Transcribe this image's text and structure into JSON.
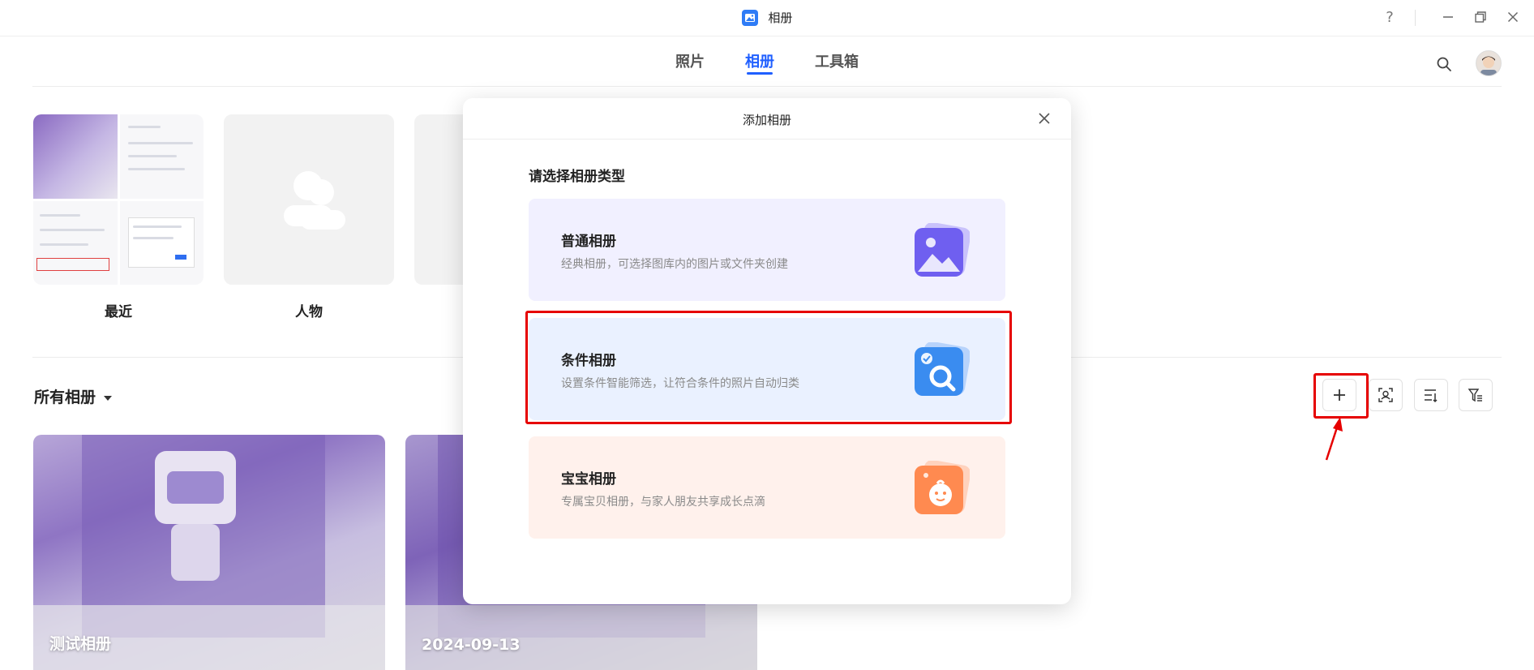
{
  "app": {
    "title": "相册",
    "icon": "album-icon",
    "accent": "#1f5fff"
  },
  "window_controls": {
    "help": "?",
    "minimize_icon": "minimize-icon",
    "restore_icon": "restore-icon",
    "close_icon": "close-icon"
  },
  "nav": {
    "tabs": [
      "照片",
      "相册",
      "工具箱"
    ],
    "active_tab": "相册"
  },
  "top_albums": [
    {
      "label": "最近"
    },
    {
      "label": "人物"
    }
  ],
  "section": {
    "title": "所有相册"
  },
  "toolbar": {
    "add": "plus-icon",
    "face_scan": "face-scan-icon",
    "sort": "sort-icon",
    "filter": "filter-icon"
  },
  "photo_albums": [
    {
      "label": "测试相册"
    },
    {
      "label": "2024-09-13"
    }
  ],
  "modal": {
    "title": "添加相册",
    "subtitle": "请选择相册类型",
    "options": [
      {
        "name": "普通相册",
        "desc": "经典相册，可选择图库内的图片或文件夹创建",
        "icon": "image-icon",
        "color": "#6f5ff0"
      },
      {
        "name": "条件相册",
        "desc": "设置条件智能筛选，让符合条件的照片自动归类",
        "icon": "smart-search-icon",
        "color": "#3a8cf0"
      },
      {
        "name": "宝宝相册",
        "desc": "专属宝贝相册，与家人朋友共享成长点滴",
        "icon": "baby-face-icon",
        "color": "#ff8a50"
      }
    ]
  },
  "annotation": {
    "highlight_color": "#e60000"
  }
}
